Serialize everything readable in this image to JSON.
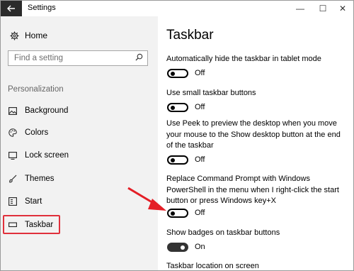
{
  "window": {
    "title": "Settings",
    "back_icon": "back-arrow-icon",
    "minimize_glyph": "—",
    "maximize_glyph": "☐",
    "close_glyph": "✕"
  },
  "sidebar": {
    "home_label": "Home",
    "search_placeholder": "Find a setting",
    "section_label": "Personalization",
    "items": [
      {
        "label": "Background",
        "icon": "picture-icon"
      },
      {
        "label": "Colors",
        "icon": "palette-icon"
      },
      {
        "label": "Lock screen",
        "icon": "monitor-icon"
      },
      {
        "label": "Themes",
        "icon": "brush-icon"
      },
      {
        "label": "Start",
        "icon": "start-menu-icon"
      },
      {
        "label": "Taskbar",
        "icon": "taskbar-icon",
        "selected": true
      }
    ],
    "highlight_color": "#e0303b"
  },
  "main": {
    "title": "Taskbar",
    "settings": [
      {
        "label": "Automatically hide the taskbar in tablet mode",
        "state": "Off"
      },
      {
        "label": "Use small taskbar buttons",
        "state": "Off"
      },
      {
        "label": "Use Peek to preview the desktop when you move your mouse to the Show desktop button at the end of the taskbar",
        "state": "Off"
      },
      {
        "label": "Replace Command Prompt with Windows PowerShell in the menu when I right-click the start button or press Windows key+X",
        "state": "Off"
      },
      {
        "label": "Show badges on taskbar buttons",
        "state": "On"
      },
      {
        "label": "Taskbar location on screen"
      }
    ]
  },
  "annotation": {
    "arrow_color": "#e41e26"
  }
}
